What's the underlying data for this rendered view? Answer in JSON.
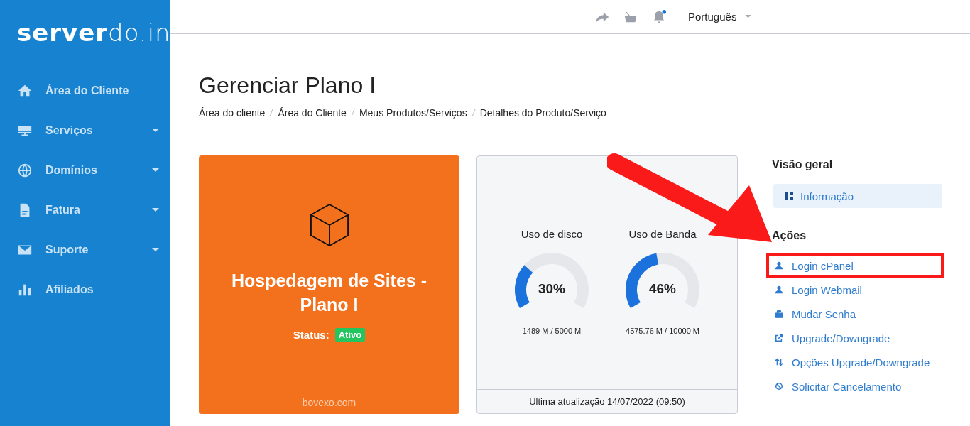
{
  "logo": "**server**do.in",
  "sidebar": {
    "items": [
      {
        "label": "Área do Cliente",
        "has_submenu": false
      },
      {
        "label": "Serviços",
        "has_submenu": true
      },
      {
        "label": "Domínios",
        "has_submenu": true
      },
      {
        "label": "Fatura",
        "has_submenu": true
      },
      {
        "label": "Suporte",
        "has_submenu": true
      },
      {
        "label": "Afiliados",
        "has_submenu": false
      }
    ]
  },
  "top_bar": {
    "notification": true,
    "language": "Português"
  },
  "page": {
    "title": "Gerenciar Plano I",
    "breadcrumb": [
      "Área do cliente",
      "Área do Cliente",
      "Meus Produtos/Serviços",
      "Detalhes do Produto/Serviço"
    ]
  },
  "product_card": {
    "name": "Hospedagem de Sites - Plano I",
    "status_label": "Status:",
    "status": "Ativo",
    "domain": "bovexo.com"
  },
  "usage_card": {
    "gauges": [
      {
        "title": "Uso de disco",
        "reading": "30%",
        "detail": "1489 M / 5000 M"
      },
      {
        "title": "Uso de Banda",
        "reading": "46%",
        "detail": "4575.76 M / 10000 M"
      }
    ],
    "footer": "Ultima atualização 14/07/2022 (09:50)"
  },
  "overview": {
    "title": "Visão geral",
    "items": [
      {
        "label": "Informação",
        "selected": true
      }
    ]
  },
  "actions": {
    "title": "Ações",
    "items": [
      {
        "label": "Login cPanel",
        "highlighted": true
      },
      {
        "label": "Login Webmail",
        "highlighted": false
      },
      {
        "label": "Mudar Senha",
        "highlighted": false
      },
      {
        "label": "Upgrade/Downgrade",
        "highlighted": false
      },
      {
        "label": "Opções Upgrade/Downgrade",
        "highlighted": false
      },
      {
        "label": "Solicitar Cancelamento",
        "highlighted": false
      }
    ]
  }
}
